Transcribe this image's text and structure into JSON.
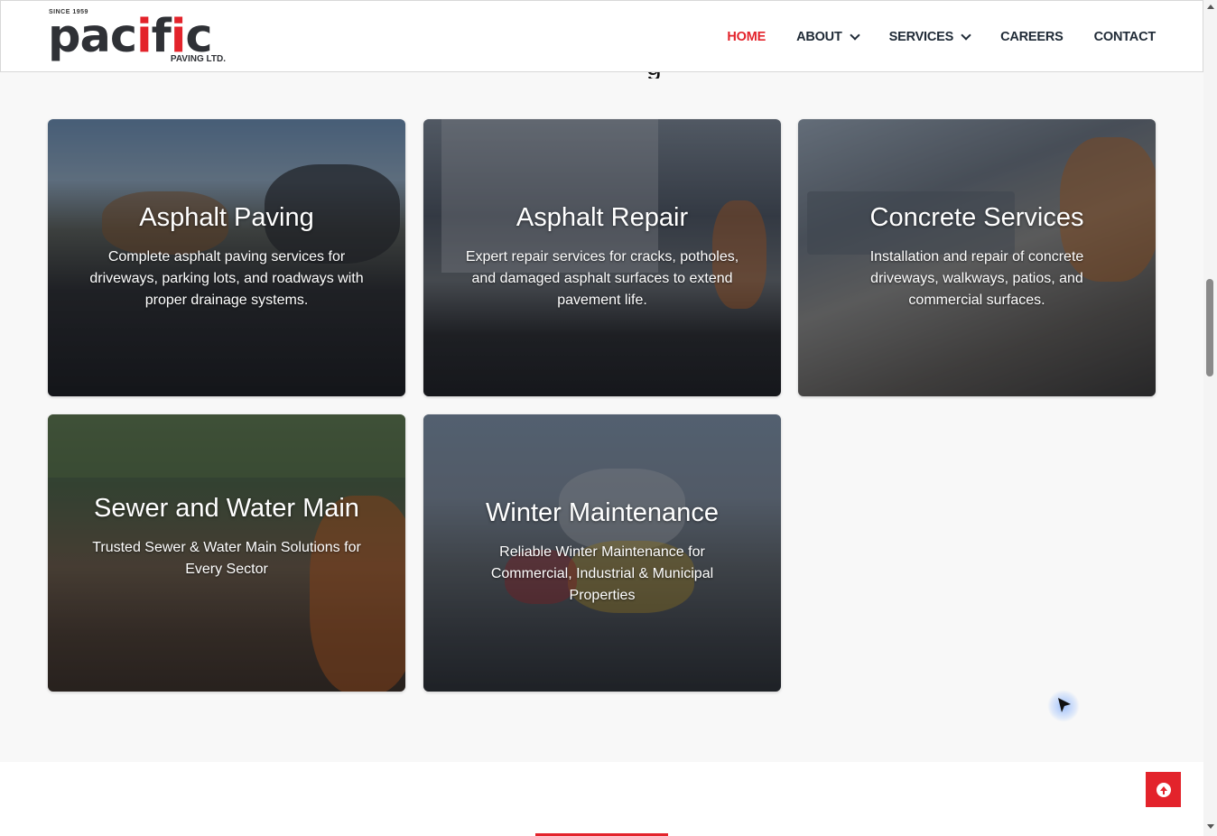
{
  "header": {
    "logo": {
      "since": "SINCE 1959",
      "brand_part1": "pac",
      "brand_part2": "i",
      "brand_part3": "f",
      "brand_part4": "i",
      "brand_part5": "c",
      "sub": "PAVING LTD."
    },
    "nav": [
      {
        "label": "HOME",
        "active": true,
        "dropdown": false
      },
      {
        "label": "ABOUT",
        "active": false,
        "dropdown": true
      },
      {
        "label": "SERVICES",
        "active": false,
        "dropdown": true
      },
      {
        "label": "CAREERS",
        "active": false,
        "dropdown": false
      },
      {
        "label": "CONTACT",
        "active": false,
        "dropdown": false
      }
    ]
  },
  "section": {
    "heading_peek": "g"
  },
  "services": [
    {
      "title": "Asphalt Paving",
      "description": "Complete asphalt paving services for driveways, parking lots, and roadways with proper drainage systems."
    },
    {
      "title": "Asphalt Repair",
      "description": "Expert repair services for cracks, potholes, and damaged asphalt surfaces to extend pavement life."
    },
    {
      "title": "Concrete Services",
      "description": "Installation and repair of concrete driveways, walkways, patios, and commercial surfaces."
    },
    {
      "title": "Sewer and Water Main",
      "description": "Trusted Sewer & Water Main Solutions for Every Sector"
    },
    {
      "title": "Winter Maintenance",
      "description": "Reliable Winter Maintenance for Commercial, Industrial & Municipal Properties"
    }
  ],
  "colors": {
    "accent": "#e3232b",
    "nav_text": "#1f2a36",
    "section_bg": "#f8f8f8"
  },
  "icons": {
    "back_to_top": "arrow-up-circle-icon",
    "cursor": "pointer-cursor-icon"
  }
}
